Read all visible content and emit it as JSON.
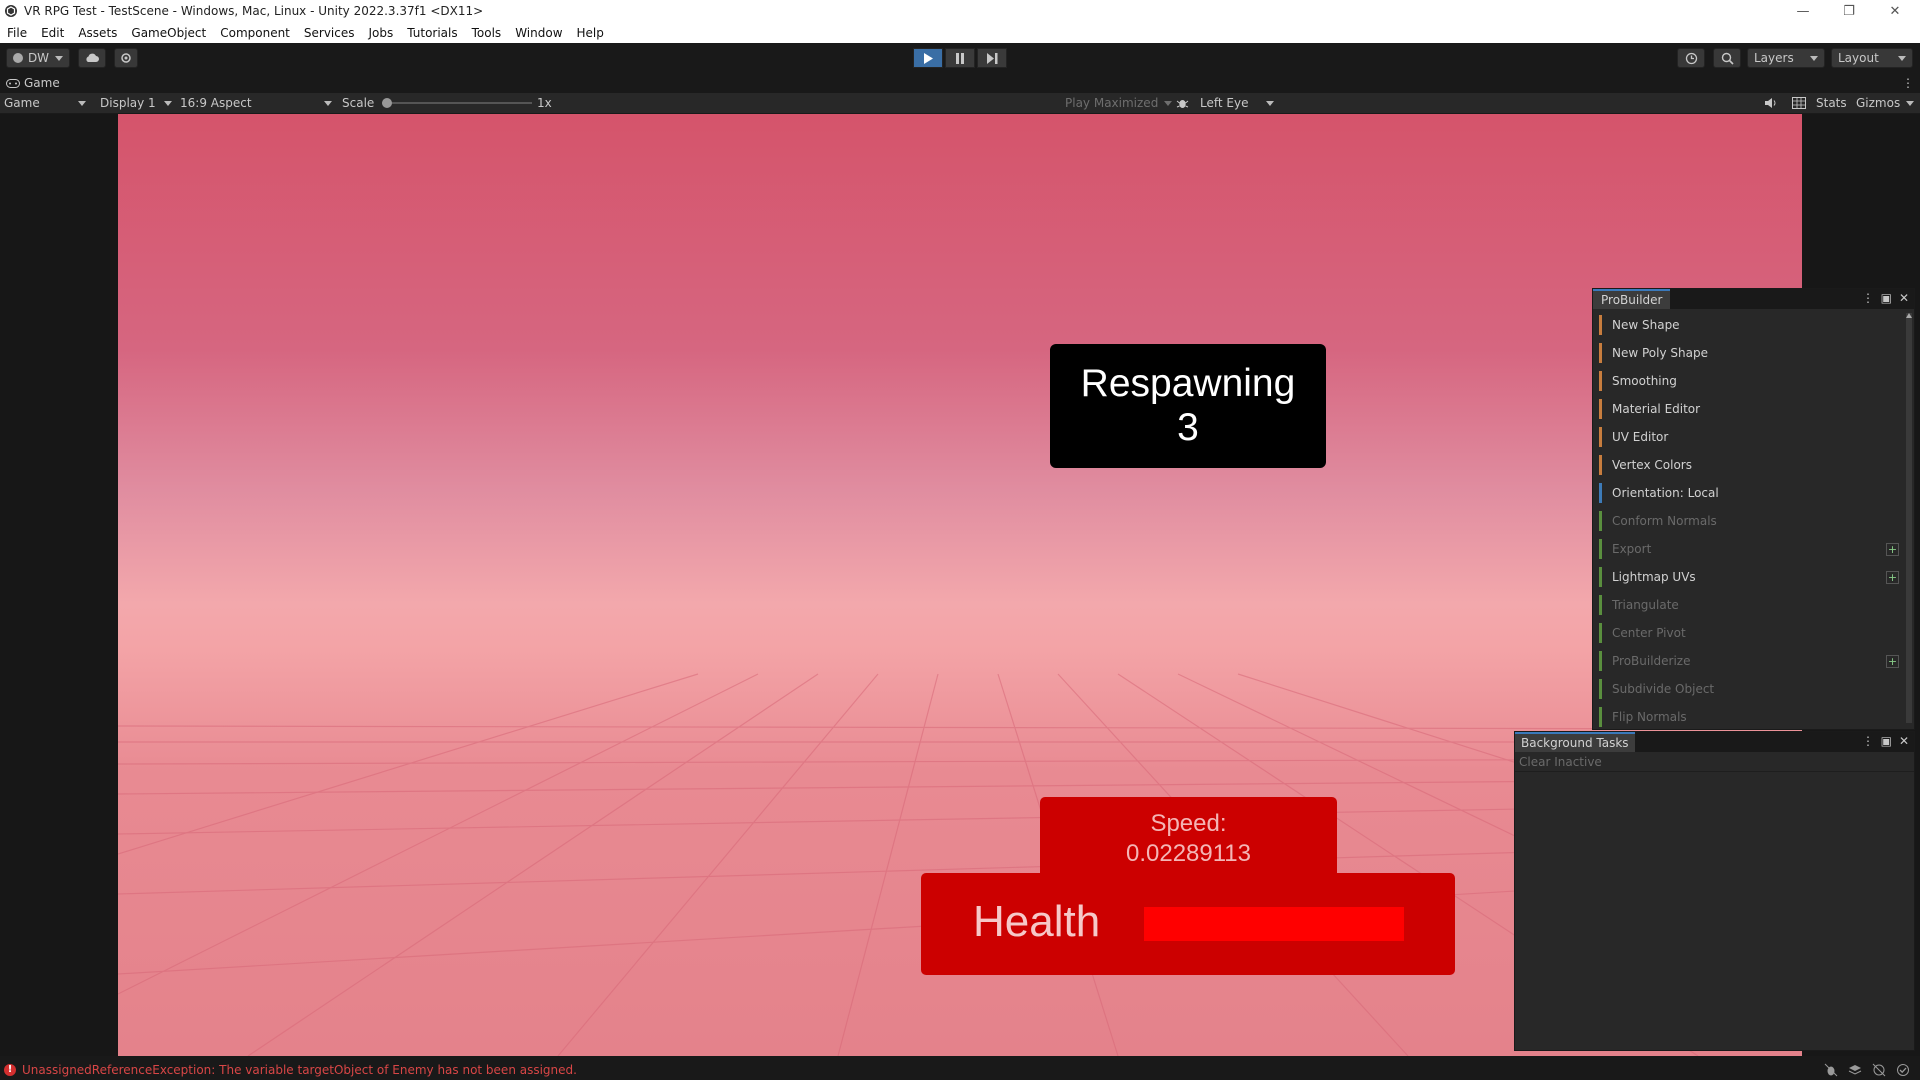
{
  "window": {
    "title": "VR RPG Test - TestScene - Windows, Mac, Linux - Unity 2022.3.37f1 <DX11>",
    "controls": [
      "—",
      "❐",
      "✕"
    ]
  },
  "menu": [
    "File",
    "Edit",
    "Assets",
    "GameObject",
    "Component",
    "Services",
    "Jobs",
    "Tutorials",
    "Tools",
    "Window",
    "Help"
  ],
  "toolbar": {
    "account_label": "DW",
    "layers_label": "Layers",
    "layout_label": "Layout"
  },
  "game_view": {
    "tab_label": "Game",
    "mode_dropdown": "Game",
    "display_dropdown": "Display 1",
    "aspect_dropdown": "16:9 Aspect",
    "scale_label": "Scale",
    "scale_value": "1x",
    "play_maximized": "Play Maximized",
    "eye_dropdown": "Left Eye",
    "stats_label": "Stats",
    "gizmos_label": "Gizmos"
  },
  "hud": {
    "respawn_title": "Respawning",
    "respawn_count": "3",
    "speed_label": "Speed:",
    "speed_value": "0.02289113",
    "health_label": "Health",
    "health_fraction": 1.0,
    "health_color": "#ff0000"
  },
  "probuilder": {
    "title": "ProBuilder",
    "items": [
      {
        "label": "New Shape",
        "color": "#c87d3e",
        "enabled": true,
        "plus": false
      },
      {
        "label": "New Poly Shape",
        "color": "#c87d3e",
        "enabled": true,
        "plus": false
      },
      {
        "label": "Smoothing",
        "color": "#c87d3e",
        "enabled": true,
        "plus": false
      },
      {
        "label": "Material Editor",
        "color": "#c87d3e",
        "enabled": true,
        "plus": false
      },
      {
        "label": "UV Editor",
        "color": "#c87d3e",
        "enabled": true,
        "plus": false
      },
      {
        "label": "Vertex Colors",
        "color": "#c87d3e",
        "enabled": true,
        "plus": false
      },
      {
        "label": "Orientation: Local",
        "color": "#3d7bb8",
        "enabled": true,
        "plus": false
      },
      {
        "label": "Conform Normals",
        "color": "#5a8f3e",
        "enabled": false,
        "plus": false
      },
      {
        "label": "Export",
        "color": "#5a8f3e",
        "enabled": false,
        "plus": true
      },
      {
        "label": "Lightmap UVs",
        "color": "#5a8f3e",
        "enabled": true,
        "plus": true
      },
      {
        "label": "Triangulate",
        "color": "#5a8f3e",
        "enabled": false,
        "plus": false
      },
      {
        "label": "Center Pivot",
        "color": "#5a8f3e",
        "enabled": false,
        "plus": false
      },
      {
        "label": "ProBuilderize",
        "color": "#5a8f3e",
        "enabled": false,
        "plus": true
      },
      {
        "label": "Subdivide Object",
        "color": "#5a8f3e",
        "enabled": false,
        "plus": false
      },
      {
        "label": "Flip Normals",
        "color": "#5a8f3e",
        "enabled": false,
        "plus": false
      }
    ]
  },
  "background_tasks": {
    "title": "Background Tasks",
    "clear_inactive": "Clear Inactive"
  },
  "status": {
    "error_message": "UnassignedReferenceException: The variable targetObject of Enemy has not been assigned.",
    "error_color": "#d84646"
  }
}
